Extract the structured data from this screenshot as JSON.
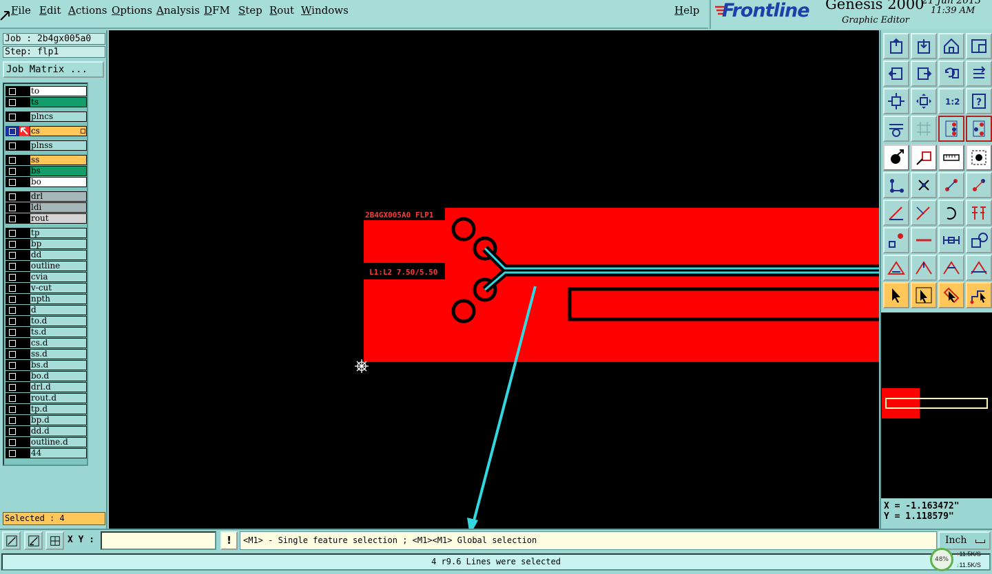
{
  "menu": {
    "items": [
      "File",
      "Edit",
      "Actions",
      "Options",
      "Analysis",
      "DFM",
      "Step",
      "Rout",
      "Windows"
    ],
    "help": "Help"
  },
  "brand": {
    "logo": "Frontline",
    "product": "Genesis 2000",
    "subtitle": "Graphic Editor",
    "date": "21 Jun 2013",
    "time": "11:39 AM"
  },
  "job": {
    "job_label": "Job : 2b4gx005a0",
    "step_label": "Step: flp1",
    "matrix_button": "Job Matrix ..."
  },
  "layers": [
    {
      "name": "to",
      "color": "#ffffff"
    },
    {
      "name": "ts",
      "color": "#149d6b"
    },
    {
      "name": "plncs",
      "color": "#a6ddd8"
    },
    {
      "name": "cs",
      "color": "#ffc65a",
      "active": true
    },
    {
      "name": "plnss",
      "color": "#a6ddd8"
    },
    {
      "name": "ss",
      "color": "#ffc65a"
    },
    {
      "name": "bs",
      "color": "#149d6b"
    },
    {
      "name": "bo",
      "color": "#ffffff"
    },
    {
      "name": "drl",
      "color": "#a7b8bb"
    },
    {
      "name": "ldi",
      "color": "#a7b8bb"
    },
    {
      "name": "rout",
      "color": "#d4d4d4"
    },
    {
      "name": "tp",
      "color": "#a6ddd8"
    },
    {
      "name": "bp",
      "color": "#a6ddd8"
    },
    {
      "name": "dd",
      "color": "#a6ddd8"
    },
    {
      "name": "outline",
      "color": "#a6ddd8"
    },
    {
      "name": "cvia",
      "color": "#a6ddd8"
    },
    {
      "name": "v-cut",
      "color": "#a6ddd8"
    },
    {
      "name": "npth",
      "color": "#a6ddd8"
    },
    {
      "name": "d",
      "color": "#a6ddd8"
    },
    {
      "name": "to.d",
      "color": "#a6ddd8"
    },
    {
      "name": "ts.d",
      "color": "#a6ddd8"
    },
    {
      "name": "cs.d",
      "color": "#a6ddd8"
    },
    {
      "name": "ss.d",
      "color": "#a6ddd8"
    },
    {
      "name": "bs.d",
      "color": "#a6ddd8"
    },
    {
      "name": "bo.d",
      "color": "#a6ddd8"
    },
    {
      "name": "drl.d",
      "color": "#a6ddd8"
    },
    {
      "name": "rout.d",
      "color": "#a6ddd8"
    },
    {
      "name": "tp.d",
      "color": "#a6ddd8"
    },
    {
      "name": "bp.d",
      "color": "#a6ddd8"
    },
    {
      "name": "dd.d",
      "color": "#a6ddd8"
    },
    {
      "name": "outline.d",
      "color": "#a6ddd8"
    },
    {
      "name": "44",
      "color": "#a6ddd8"
    }
  ],
  "selected": "Selected : 4",
  "canvas": {
    "board_label": "2B4GX005A0 FLP1",
    "layer_label": "L1:L2 7.50/5.50"
  },
  "coords": {
    "x": "X = -1.163472\"",
    "y": "Y = 1.118579\""
  },
  "bottom": {
    "xy_label": "X Y :",
    "xy_value": "",
    "warn": "!",
    "prompt": "<M1> - Single feature selection ; <M1><M1> Global selection",
    "unit": "Inch",
    "status": "4 r9.6 Lines were selected"
  },
  "network": {
    "percent": "48%",
    "up": "11.5K/S",
    "down": "11.5K/S"
  },
  "colors": {
    "panel": "#9dd7d3",
    "copper": "#ff0000",
    "selected_trace": "#34d6e0",
    "highlight": "#ffc65a"
  },
  "toolbar": {
    "icons": [
      "open-layer-icon",
      "save-layer-icon",
      "home-icon",
      "window-icon",
      "pan-left-icon",
      "pan-right-icon",
      "undo-view-icon",
      "redo-view-icon",
      "zoom-fit-icon",
      "zoom-center-icon",
      "zoom-1to2-icon",
      "help-icon",
      "display-settings-icon",
      "grid-icon",
      "route-check-icon",
      "net-check-icon",
      "add-pad-icon",
      "add-surface-icon",
      "ruler-icon",
      "circle-pad-icon",
      "connect-nodes-icon",
      "delete-node-icon",
      "line-edit-icon",
      "line-edit-alt-icon",
      "angle-icon",
      "draw-line-icon",
      "arc-icon",
      "text-icon",
      "snap-icon",
      "horizontal-line-icon",
      "measure-icon",
      "copy-feature-icon",
      "triangle-a-icon",
      "triangle-b-icon",
      "triangle-c-icon",
      "triangle-d-icon",
      "select-arrow-icon",
      "select-arrow-alt-icon",
      "select-window-icon",
      "route-select-icon"
    ]
  }
}
